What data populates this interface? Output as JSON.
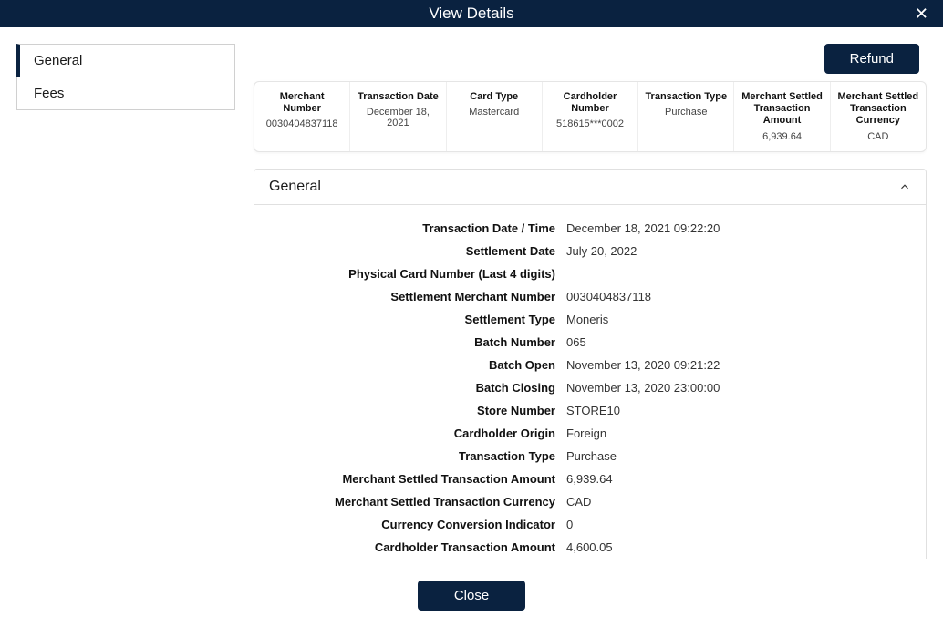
{
  "title": "View Details",
  "sidebar": {
    "items": [
      {
        "label": "General"
      },
      {
        "label": "Fees"
      }
    ]
  },
  "buttons": {
    "refund": "Refund",
    "close": "Close"
  },
  "summary": [
    {
      "label": "Merchant Number",
      "value": "0030404837118"
    },
    {
      "label": "Transaction Date",
      "value": "December 18, 2021"
    },
    {
      "label": "Card Type",
      "value": "Mastercard"
    },
    {
      "label": "Cardholder Number",
      "value": "518615***0002"
    },
    {
      "label": "Transaction Type",
      "value": "Purchase"
    },
    {
      "label": "Merchant Settled Transaction Amount",
      "value": "6,939.64"
    },
    {
      "label": "Merchant Settled Transaction Currency",
      "value": "CAD"
    }
  ],
  "panel": {
    "title": "General",
    "rows": [
      {
        "label": "Transaction Date / Time",
        "value": "December 18, 2021 09:22:20"
      },
      {
        "label": "Settlement Date",
        "value": "July 20, 2022"
      },
      {
        "label": "Physical Card Number (Last 4 digits)",
        "value": ""
      },
      {
        "label": "Settlement Merchant Number",
        "value": "0030404837118"
      },
      {
        "label": "Settlement Type",
        "value": "Moneris"
      },
      {
        "label": "Batch Number",
        "value": "065"
      },
      {
        "label": "Batch Open",
        "value": "November 13, 2020 09:21:22"
      },
      {
        "label": "Batch Closing",
        "value": "November 13, 2020 23:00:00"
      },
      {
        "label": "Store Number",
        "value": "STORE10"
      },
      {
        "label": "Cardholder Origin",
        "value": "Foreign"
      },
      {
        "label": "Transaction Type",
        "value": "Purchase"
      },
      {
        "label": "Merchant Settled Transaction Amount",
        "value": "6,939.64"
      },
      {
        "label": "Merchant Settled Transaction Currency",
        "value": "CAD"
      },
      {
        "label": "Currency Conversion Indicator",
        "value": "0"
      },
      {
        "label": "Cardholder Transaction Amount",
        "value": "4,600.05"
      }
    ]
  }
}
